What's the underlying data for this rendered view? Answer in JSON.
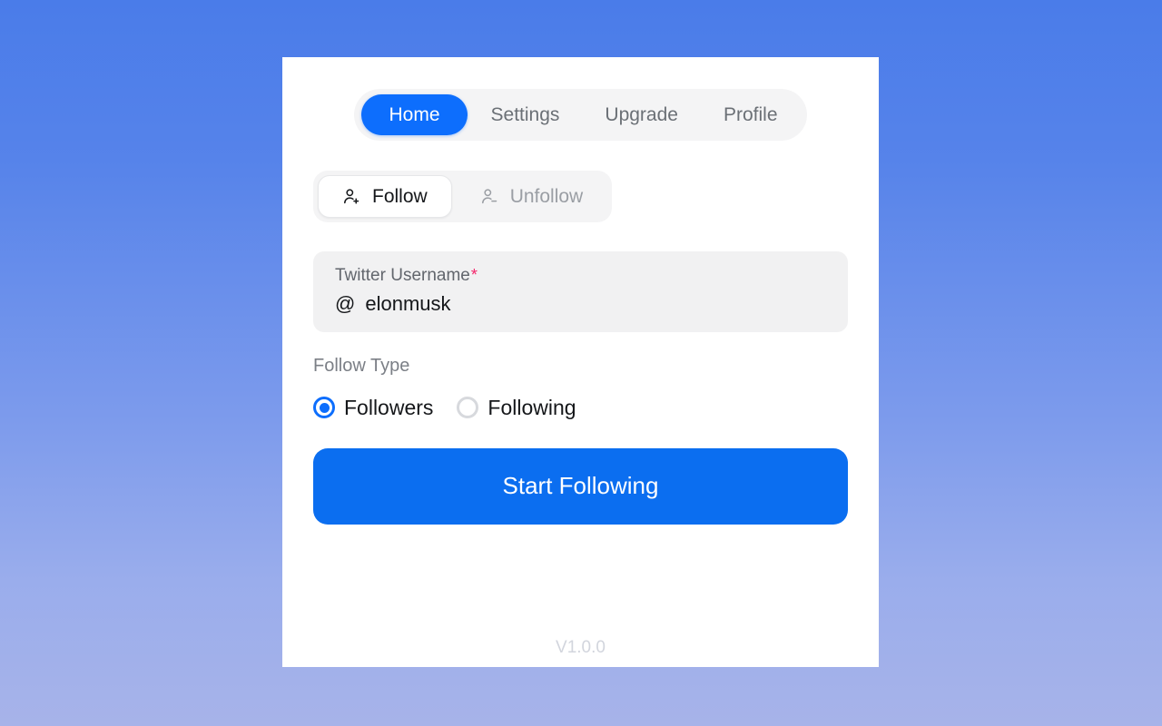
{
  "theme": {
    "accent": "#0d6efd",
    "button": "#0b6ef0",
    "bg_gradient_top": "#4a7ce9",
    "bg_gradient_bottom": "#a7b3e9",
    "card_bg": "#ffffff",
    "muted_text": "#6b7076",
    "required_star": "#f4256a",
    "field_bg": "#f1f1f2",
    "segment_bg": "#f4f4f5"
  },
  "tabs": [
    {
      "label": "Home",
      "active": true
    },
    {
      "label": "Settings",
      "active": false
    },
    {
      "label": "Upgrade",
      "active": false
    },
    {
      "label": "Profile",
      "active": false
    }
  ],
  "mode_toggle": {
    "options": [
      {
        "label": "Follow",
        "icon": "user-plus-icon",
        "active": true
      },
      {
        "label": "Unfollow",
        "icon": "user-minus-icon",
        "active": false
      }
    ]
  },
  "username_field": {
    "label": "Twitter Username",
    "required_marker": "*",
    "prefix": "@",
    "value": "elonmusk",
    "placeholder": "elonmusk"
  },
  "follow_type": {
    "label": "Follow Type",
    "options": [
      {
        "label": "Followers",
        "selected": true
      },
      {
        "label": "Following",
        "selected": false
      }
    ]
  },
  "submit": {
    "label": "Start Following"
  },
  "footer": {
    "version": "V1.0.0"
  }
}
